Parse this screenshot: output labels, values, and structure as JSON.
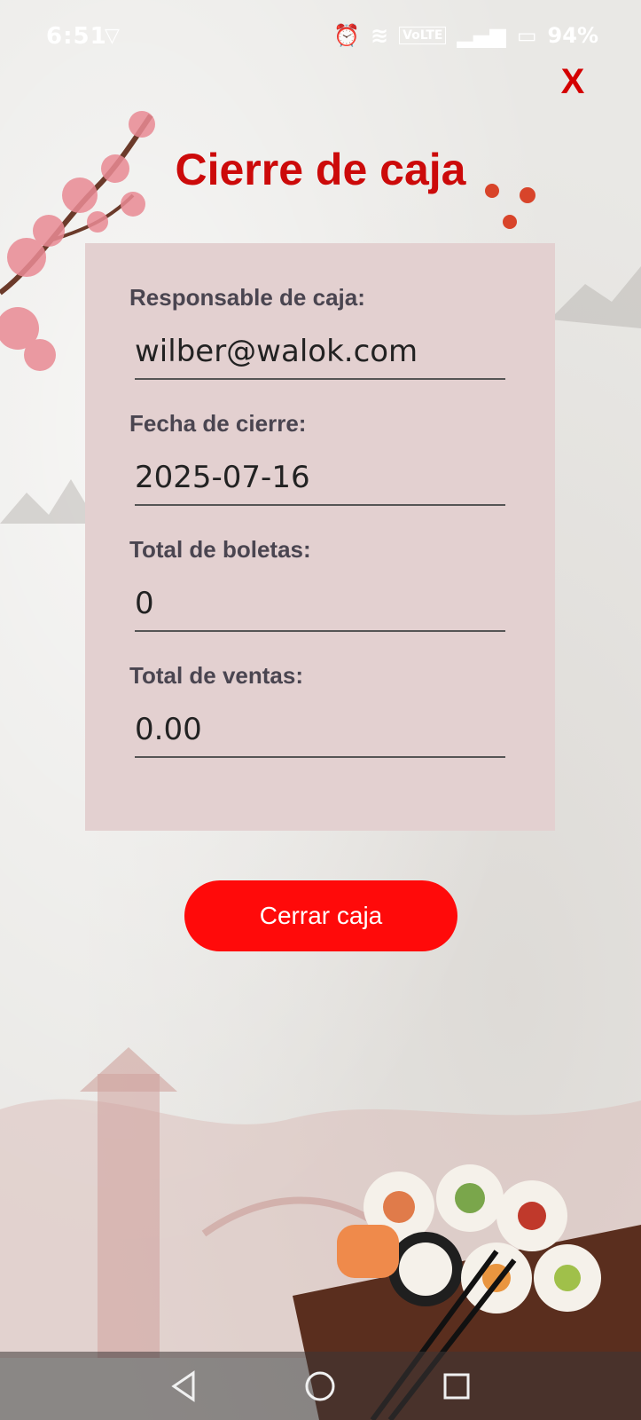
{
  "status_bar": {
    "time": "6:51",
    "battery": "94%",
    "network_label": "VoLTE"
  },
  "dialog": {
    "title": "Cierre de caja",
    "close_label": "X"
  },
  "form": {
    "fields": [
      {
        "label": "Responsable de caja:",
        "value": "wilber@walok.com"
      },
      {
        "label": "Fecha de cierre:",
        "value": "2025-07-16"
      },
      {
        "label": "Total de boletas:",
        "value": "0"
      },
      {
        "label": "Total de ventas:",
        "value": "0.00"
      }
    ],
    "submit_label": "Cerrar caja"
  },
  "icons": {
    "close": "close-icon",
    "back": "back-triangle-icon",
    "home": "home-circle-icon",
    "recents": "recents-square-icon"
  },
  "colors": {
    "title": "#cc0a0a",
    "close": "#d40000",
    "button": "#ff0a0a",
    "card": "#e3d0d0",
    "label": "#4a4550"
  }
}
